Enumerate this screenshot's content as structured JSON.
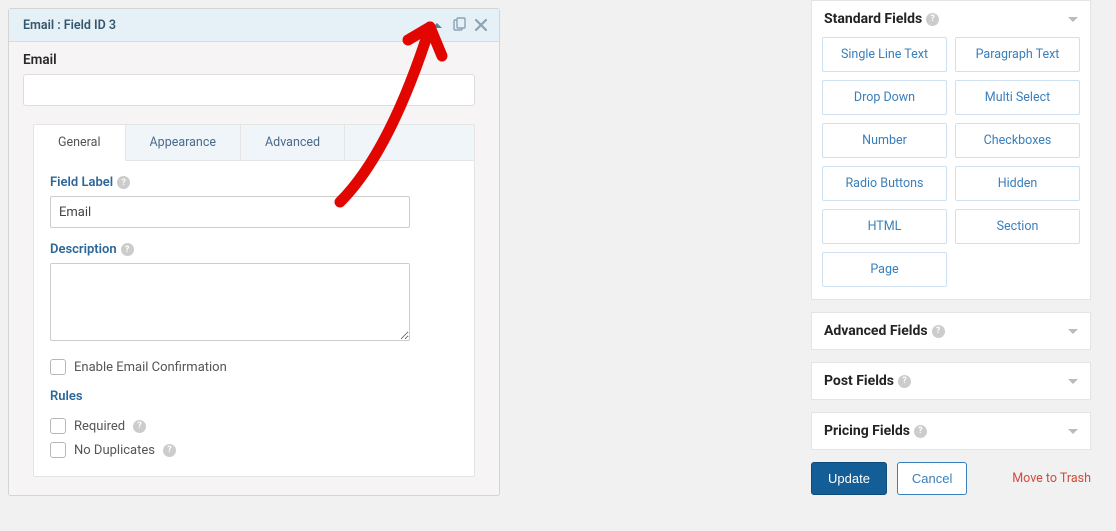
{
  "field_editor": {
    "header_title": "Email : Field ID 3",
    "preview_label": "Email",
    "preview_value": "",
    "tabs": [
      "General",
      "Appearance",
      "Advanced"
    ],
    "field_label_caption": "Field Label",
    "field_label_value": "Email",
    "description_caption": "Description",
    "description_value": "",
    "enable_conf": "Enable Email Confirmation",
    "rules_heading": "Rules",
    "required_label": "Required",
    "no_dup_label": "No Duplicates"
  },
  "sidebar": {
    "standard_title": "Standard Fields",
    "standard_items": [
      "Single Line Text",
      "Paragraph Text",
      "Drop Down",
      "Multi Select",
      "Number",
      "Checkboxes",
      "Radio Buttons",
      "Hidden",
      "HTML",
      "Section",
      "Page"
    ],
    "advanced_title": "Advanced Fields",
    "post_title": "Post Fields",
    "pricing_title": "Pricing Fields"
  },
  "actions": {
    "update": "Update",
    "cancel": "Cancel",
    "trash": "Move to Trash"
  }
}
